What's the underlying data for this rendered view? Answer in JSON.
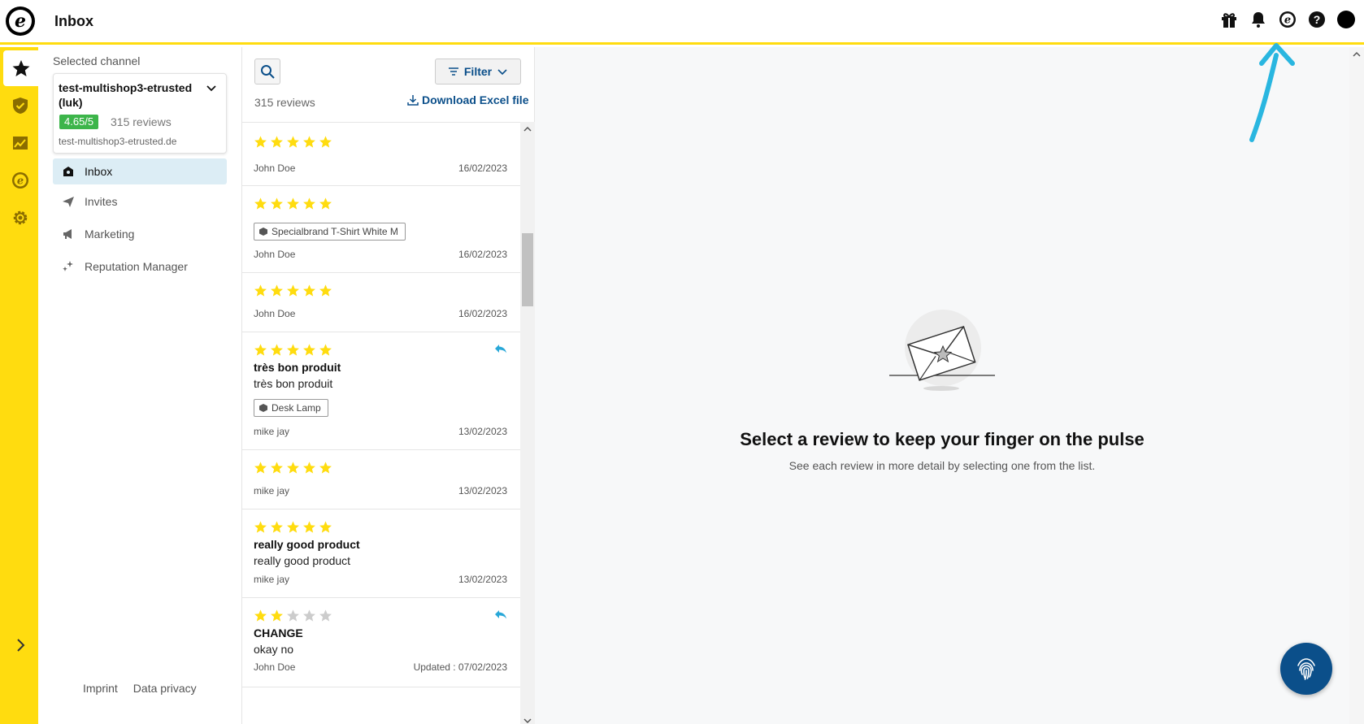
{
  "header": {
    "title": "Inbox",
    "icons": [
      "gift-icon",
      "bell-icon",
      "etrusted-icon",
      "help-icon",
      "avatar"
    ]
  },
  "rail": {
    "items": [
      "star-icon",
      "shield-check-icon",
      "chart-icon",
      "etrusted-icon",
      "gear-icon"
    ],
    "expand_icon": "chevron-right-icon"
  },
  "channel": {
    "label": "Selected channel",
    "name": "test-multishop3-etrusted (luk)",
    "rating": "4.65/5",
    "reviews": "315 reviews",
    "url": "test-multishop3-etrusted.de"
  },
  "nav": {
    "items": [
      {
        "label": "Inbox",
        "icon": "inbox-icon"
      },
      {
        "label": "Invites",
        "icon": "send-icon"
      },
      {
        "label": "Marketing",
        "icon": "megaphone-icon"
      },
      {
        "label": "Reputation Manager",
        "icon": "sparkle-icon"
      }
    ],
    "footer": [
      "Imprint",
      "Data privacy"
    ]
  },
  "list": {
    "filter_label": "Filter",
    "count": "315 reviews",
    "download": "Download Excel file",
    "reviews": [
      {
        "stars": 5,
        "title": "",
        "body": "",
        "tag": "",
        "author": "John Doe",
        "date": "16/02/2023",
        "reply": false
      },
      {
        "stars": 5,
        "title": "",
        "body": "",
        "tag": "Specialbrand T-Shirt White M",
        "author": "John Doe",
        "date": "16/02/2023",
        "reply": false
      },
      {
        "stars": 5,
        "title": "",
        "body": "",
        "tag": "",
        "author": "John Doe",
        "date": "16/02/2023",
        "reply": false
      },
      {
        "stars": 5,
        "title": "très bon produit",
        "body": "très bon produit",
        "tag": "Desk Lamp",
        "author": "mike jay",
        "date": "13/02/2023",
        "reply": true
      },
      {
        "stars": 5,
        "title": "",
        "body": "",
        "tag": "",
        "author": "mike jay",
        "date": "13/02/2023",
        "reply": false
      },
      {
        "stars": 5,
        "title": "really good product",
        "body": "really good product",
        "tag": "",
        "author": "mike jay",
        "date": "13/02/2023",
        "reply": false
      },
      {
        "stars": 2,
        "title": "CHANGE",
        "body": "okay no",
        "tag": "",
        "author": "John Doe",
        "date": "Updated : 07/02/2023",
        "reply": true
      }
    ]
  },
  "main": {
    "title": "Select a review to keep your finger on the pulse",
    "subtitle": "See each review in more detail by selecting one from the list."
  },
  "colors": {
    "brand_yellow": "#ffdc0f",
    "brand_blue": "#0b4f8a",
    "star_yellow": "#ffdc0f",
    "star_empty": "#cccccc",
    "badge_green": "#3cb54a",
    "annotation": "#29b6e0"
  }
}
